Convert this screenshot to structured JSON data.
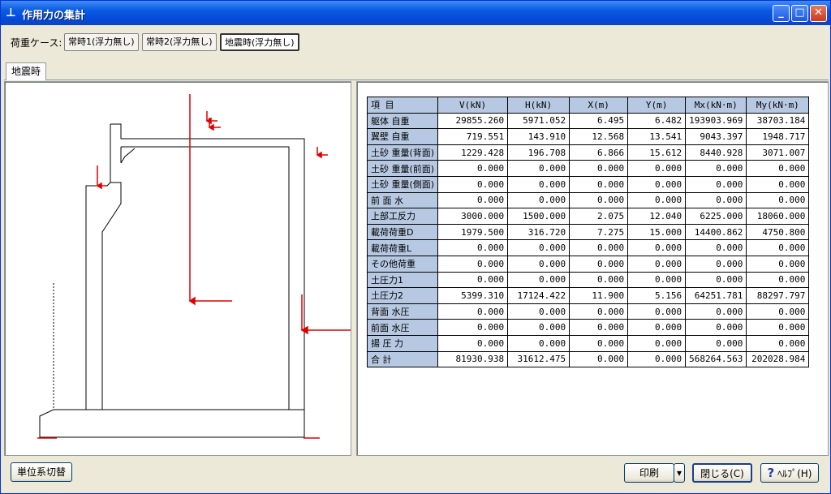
{
  "window": {
    "title": "作用力の集計",
    "app_icon": "⊥",
    "minimize_label": "_",
    "maximize_label": "□",
    "close_label": "✕"
  },
  "cases": {
    "label": "荷重ケース:",
    "buttons": [
      "常時1(浮力無し)",
      "常時2(浮力無し)",
      "地震時(浮力無し)"
    ],
    "selected_index": 2
  },
  "tabs": [
    "地震時"
  ],
  "table": {
    "headers": [
      "項 目",
      "V(kN)",
      "H(kN)",
      "X(m)",
      "Y(m)",
      "Mx(kN·m)",
      "My(kN·m)"
    ],
    "rows": [
      [
        "躯体 自重",
        "29855.260",
        "5971.052",
        "6.495",
        "6.482",
        "193903.969",
        "38703.184"
      ],
      [
        "翼壁 自重",
        "719.551",
        "143.910",
        "12.568",
        "13.541",
        "9043.397",
        "1948.717"
      ],
      [
        "土砂 重量(背面)",
        "1229.428",
        "196.708",
        "6.866",
        "15.612",
        "8440.928",
        "3071.007"
      ],
      [
        "土砂 重量(前面)",
        "0.000",
        "0.000",
        "0.000",
        "0.000",
        "0.000",
        "0.000"
      ],
      [
        "土砂 重量(側面)",
        "0.000",
        "0.000",
        "0.000",
        "0.000",
        "0.000",
        "0.000"
      ],
      [
        "前 面 水",
        "0.000",
        "0.000",
        "0.000",
        "0.000",
        "0.000",
        "0.000"
      ],
      [
        "上部工反力",
        "3000.000",
        "1500.000",
        "2.075",
        "12.040",
        "6225.000",
        "18060.000"
      ],
      [
        "載荷荷重D",
        "1979.500",
        "316.720",
        "7.275",
        "15.000",
        "14400.862",
        "4750.800"
      ],
      [
        "載荷荷重L",
        "0.000",
        "0.000",
        "0.000",
        "0.000",
        "0.000",
        "0.000"
      ],
      [
        "その他荷重",
        "0.000",
        "0.000",
        "0.000",
        "0.000",
        "0.000",
        "0.000"
      ],
      [
        "土圧力1",
        "0.000",
        "0.000",
        "0.000",
        "0.000",
        "0.000",
        "0.000"
      ],
      [
        "土圧力2",
        "5399.310",
        "17124.422",
        "11.900",
        "5.156",
        "64251.781",
        "88297.797"
      ],
      [
        "背面 水圧",
        "0.000",
        "0.000",
        "0.000",
        "0.000",
        "0.000",
        "0.000"
      ],
      [
        "前面 水圧",
        "0.000",
        "0.000",
        "0.000",
        "0.000",
        "0.000",
        "0.000"
      ],
      [
        "揚 圧 力",
        "0.000",
        "0.000",
        "0.000",
        "0.000",
        "0.000",
        "0.000"
      ],
      [
        "合 計",
        "81930.938",
        "31612.475",
        "0.000",
        "0.000",
        "568264.563",
        "202028.984"
      ]
    ]
  },
  "footer": {
    "unit_switch_label": "単位系切替",
    "print_label": "印刷",
    "print_dropdown_glyph": "▾",
    "close_label": "閉じる(C)",
    "help_icon": "?",
    "help_label": "ﾍﾙﾌﾟ(H)"
  },
  "colors": {
    "titlebar": "#0a5ae3",
    "header_cell": "#b7c9e2",
    "force_arrow": "#e00000"
  }
}
